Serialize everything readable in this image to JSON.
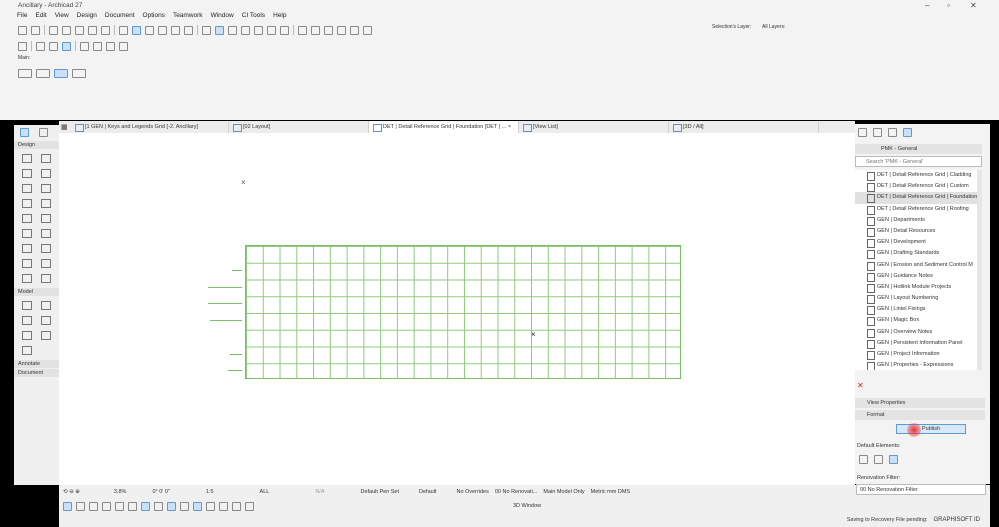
{
  "window": {
    "title": "Ancillary - Archicad 27",
    "minimize": "–",
    "restore": "▫",
    "close": "✕"
  },
  "menu": [
    "File",
    "Edit",
    "View",
    "Design",
    "Document",
    "Options",
    "Teamwork",
    "Window",
    "CI Tools",
    "Help"
  ],
  "toolbar": {
    "selection_layer": "Selection's Layer:",
    "all_layers": "All Layers:",
    "main_label": "Main:"
  },
  "toolbox": {
    "sections": [
      "Design",
      "Model",
      "Annotate",
      "Document"
    ]
  },
  "tabs": [
    {
      "label": "[1 GEN | Keys and Legends Grid [-2. Ancillary]"
    },
    {
      "label": "[02 Layout]"
    },
    {
      "label": "DET | Detail Reference Grid | Foundation [DET | ...",
      "active": true,
      "close": "×"
    },
    {
      "label": "[View List]"
    },
    {
      "label": "[3D / All]"
    }
  ],
  "navigator": {
    "header": "PMK - General",
    "search_placeholder": "Search 'PMK - General'",
    "items": [
      "DET | Detail Reference Grid | Cladding",
      "DET | Detail Reference Grid | Custom",
      "DET | Detail Reference Grid | Foundation",
      "DET | Detail Reference Grid | Roofing",
      "GEN | Departments",
      "GEN | Detail Resources",
      "GEN | Development",
      "GEN | Drafting Standards",
      "GEN | Erosion and Sediment Control M",
      "GEN | Guidance Notes",
      "GEN | Hotlink Module Projects",
      "GEN | Layout Numbering",
      "GEN | Lintel Fixings",
      "GEN | Magic Box",
      "GEN | Overview Notes",
      "GEN | Persistent Information Panel",
      "GEN | Project Information",
      "GEN | Properties - Expressions"
    ],
    "selected_index": 2,
    "view_properties": "View Properties",
    "format": "Format",
    "publish": "Publish",
    "default_elements": "Default Elements:",
    "renovation_filter_label": "Renovation Filter:",
    "renovation_filter_value": "00 No Renovation Filter"
  },
  "statusbar": {
    "zoom": "3.8%",
    "angle": "0° 0' 0\"",
    "scale": "1:5",
    "layer": "ALL",
    "na": "N/A",
    "pen_set": "Default Pen Set",
    "default": "Default",
    "overrides": "No Overrides",
    "renovation": "00 No Renovati...",
    "model": "Main Model Only",
    "dimension": "Metric mm DMS",
    "window3d": "3D Window",
    "saving": "Saving to Recovery File pending:",
    "graphisoft": "GRAPHISOFT ID"
  },
  "colors": {
    "grid": "#7dbd6a",
    "accent": "#5a9bd8"
  }
}
